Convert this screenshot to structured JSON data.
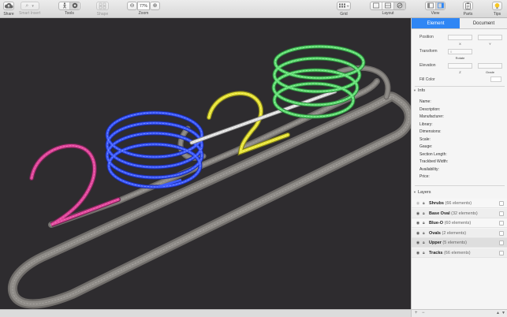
{
  "toolbar": {
    "share": {
      "label": "Share",
      "icon": "cloud-upload-icon"
    },
    "smart_insert": {
      "label": "Smart Insert",
      "icon": "magnifier-icon"
    },
    "tools": {
      "label": "Tools",
      "icons": [
        "walker-icon",
        "eye-icon"
      ]
    },
    "shape": {
      "label": "Shape",
      "icon": "shape-icon"
    },
    "zoom": {
      "label": "Zoom",
      "value": "77%",
      "out_icon": "zoom-out-icon",
      "in_icon": "zoom-in-icon"
    },
    "grid": {
      "label": "Grid",
      "icon": "grid-icon"
    },
    "layout": {
      "label": "Layout",
      "icons": [
        "layout-single-icon",
        "layout-split-icon",
        "layout-3d-icon"
      ]
    },
    "view": {
      "label": "View",
      "icons": [
        "view-left-icon",
        "view-right-icon"
      ]
    },
    "parts": {
      "label": "Parts",
      "icon": "clipboard-icon"
    },
    "tips": {
      "label": "Tips",
      "icon": "lightbulb-icon"
    }
  },
  "inspector": {
    "tabs": [
      {
        "label": "Element",
        "active": true
      },
      {
        "label": "Document",
        "active": false
      }
    ],
    "position": {
      "label": "Position",
      "x_label": "X",
      "y_label": "Y"
    },
    "transform": {
      "label": "Transform",
      "value": "0",
      "sub_label": "Rotate"
    },
    "elevation": {
      "label": "Elevation",
      "z_label": "Z",
      "grade_label": "Grade"
    },
    "fill_color": {
      "label": "Fill Color"
    },
    "info": {
      "title": "Info",
      "rows": [
        "Name:",
        "Description:",
        "Manufacturer:",
        "Library:",
        "Dimensions:",
        "Scale:",
        "Gauge:",
        "Section Length:",
        "Trackbed Width:",
        "Availability:",
        "Price:"
      ]
    },
    "layers": {
      "title": "Layers",
      "items": [
        {
          "name": "Shrubs",
          "count": "(66 elements)",
          "visible": false
        },
        {
          "name": "Base Oval",
          "count": "(32 elements)",
          "visible": true
        },
        {
          "name": "Blue-O",
          "count": "(60 elements)",
          "visible": true
        },
        {
          "name": "Ovals",
          "count": "(2 elements)",
          "visible": true
        },
        {
          "name": "Upper",
          "count": "(5 elements)",
          "visible": true
        },
        {
          "name": "Tracks",
          "count": "(66 elements)",
          "visible": true
        }
      ]
    },
    "footer": {
      "add": "+",
      "remove": "−",
      "up": "▲",
      "down": "▼"
    }
  },
  "colors": {
    "canvas": "#2e2c2f",
    "accent": "#2f86f4",
    "track_gray": "#8a8784",
    "track_pink": "#e0449a",
    "track_blue": "#2c49f0",
    "track_yellow": "#e8e436",
    "track_green": "#56d36a",
    "track_white": "#e4e4e4"
  }
}
